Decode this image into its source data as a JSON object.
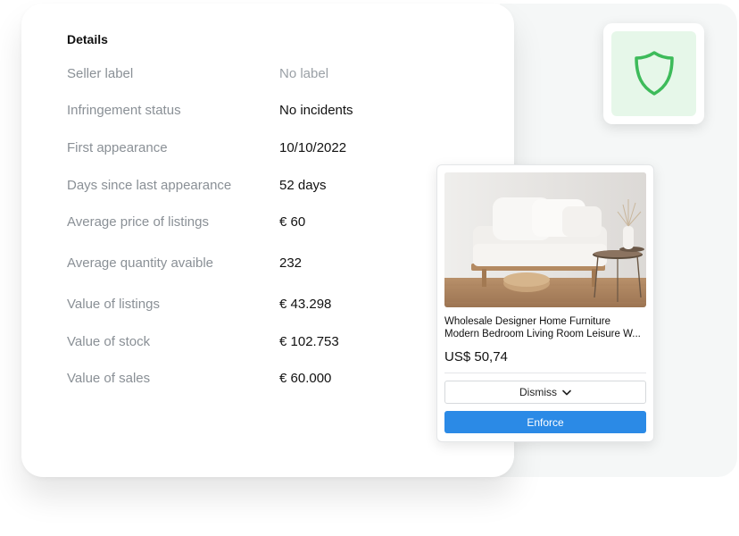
{
  "details": {
    "title": "Details",
    "rows": [
      {
        "label": "Seller label",
        "value": "No label"
      },
      {
        "label": "Infringement status",
        "value": "No incidents"
      },
      {
        "label": "First appearance",
        "value": "10/10/2022"
      },
      {
        "label": "Days since last appearance",
        "value": "52 days"
      },
      {
        "label": "Average price of listings",
        "value": "€ 60"
      },
      {
        "label": "Average quantity avaible",
        "value": "232"
      },
      {
        "label": "Value of listings",
        "value": "€ 43.298"
      },
      {
        "label": "Value of stock",
        "value": "€ 102.753"
      },
      {
        "label": "Value of sales",
        "value": "€ 60.000"
      }
    ]
  },
  "badge": {
    "icon": "shield-icon",
    "color": "#3dbb5a",
    "background": "#e6f7e9"
  },
  "product": {
    "title_line1": "Wholesale Designer Home Furniture",
    "title_line2": "Modern Bedroom Living Room Leisure W...",
    "price": "US$ 50,74",
    "dismiss_label": "Dismiss",
    "dismiss_icon": "chevron-down-icon",
    "enforce_label": "Enforce",
    "accent_color": "#2b8ae6"
  }
}
